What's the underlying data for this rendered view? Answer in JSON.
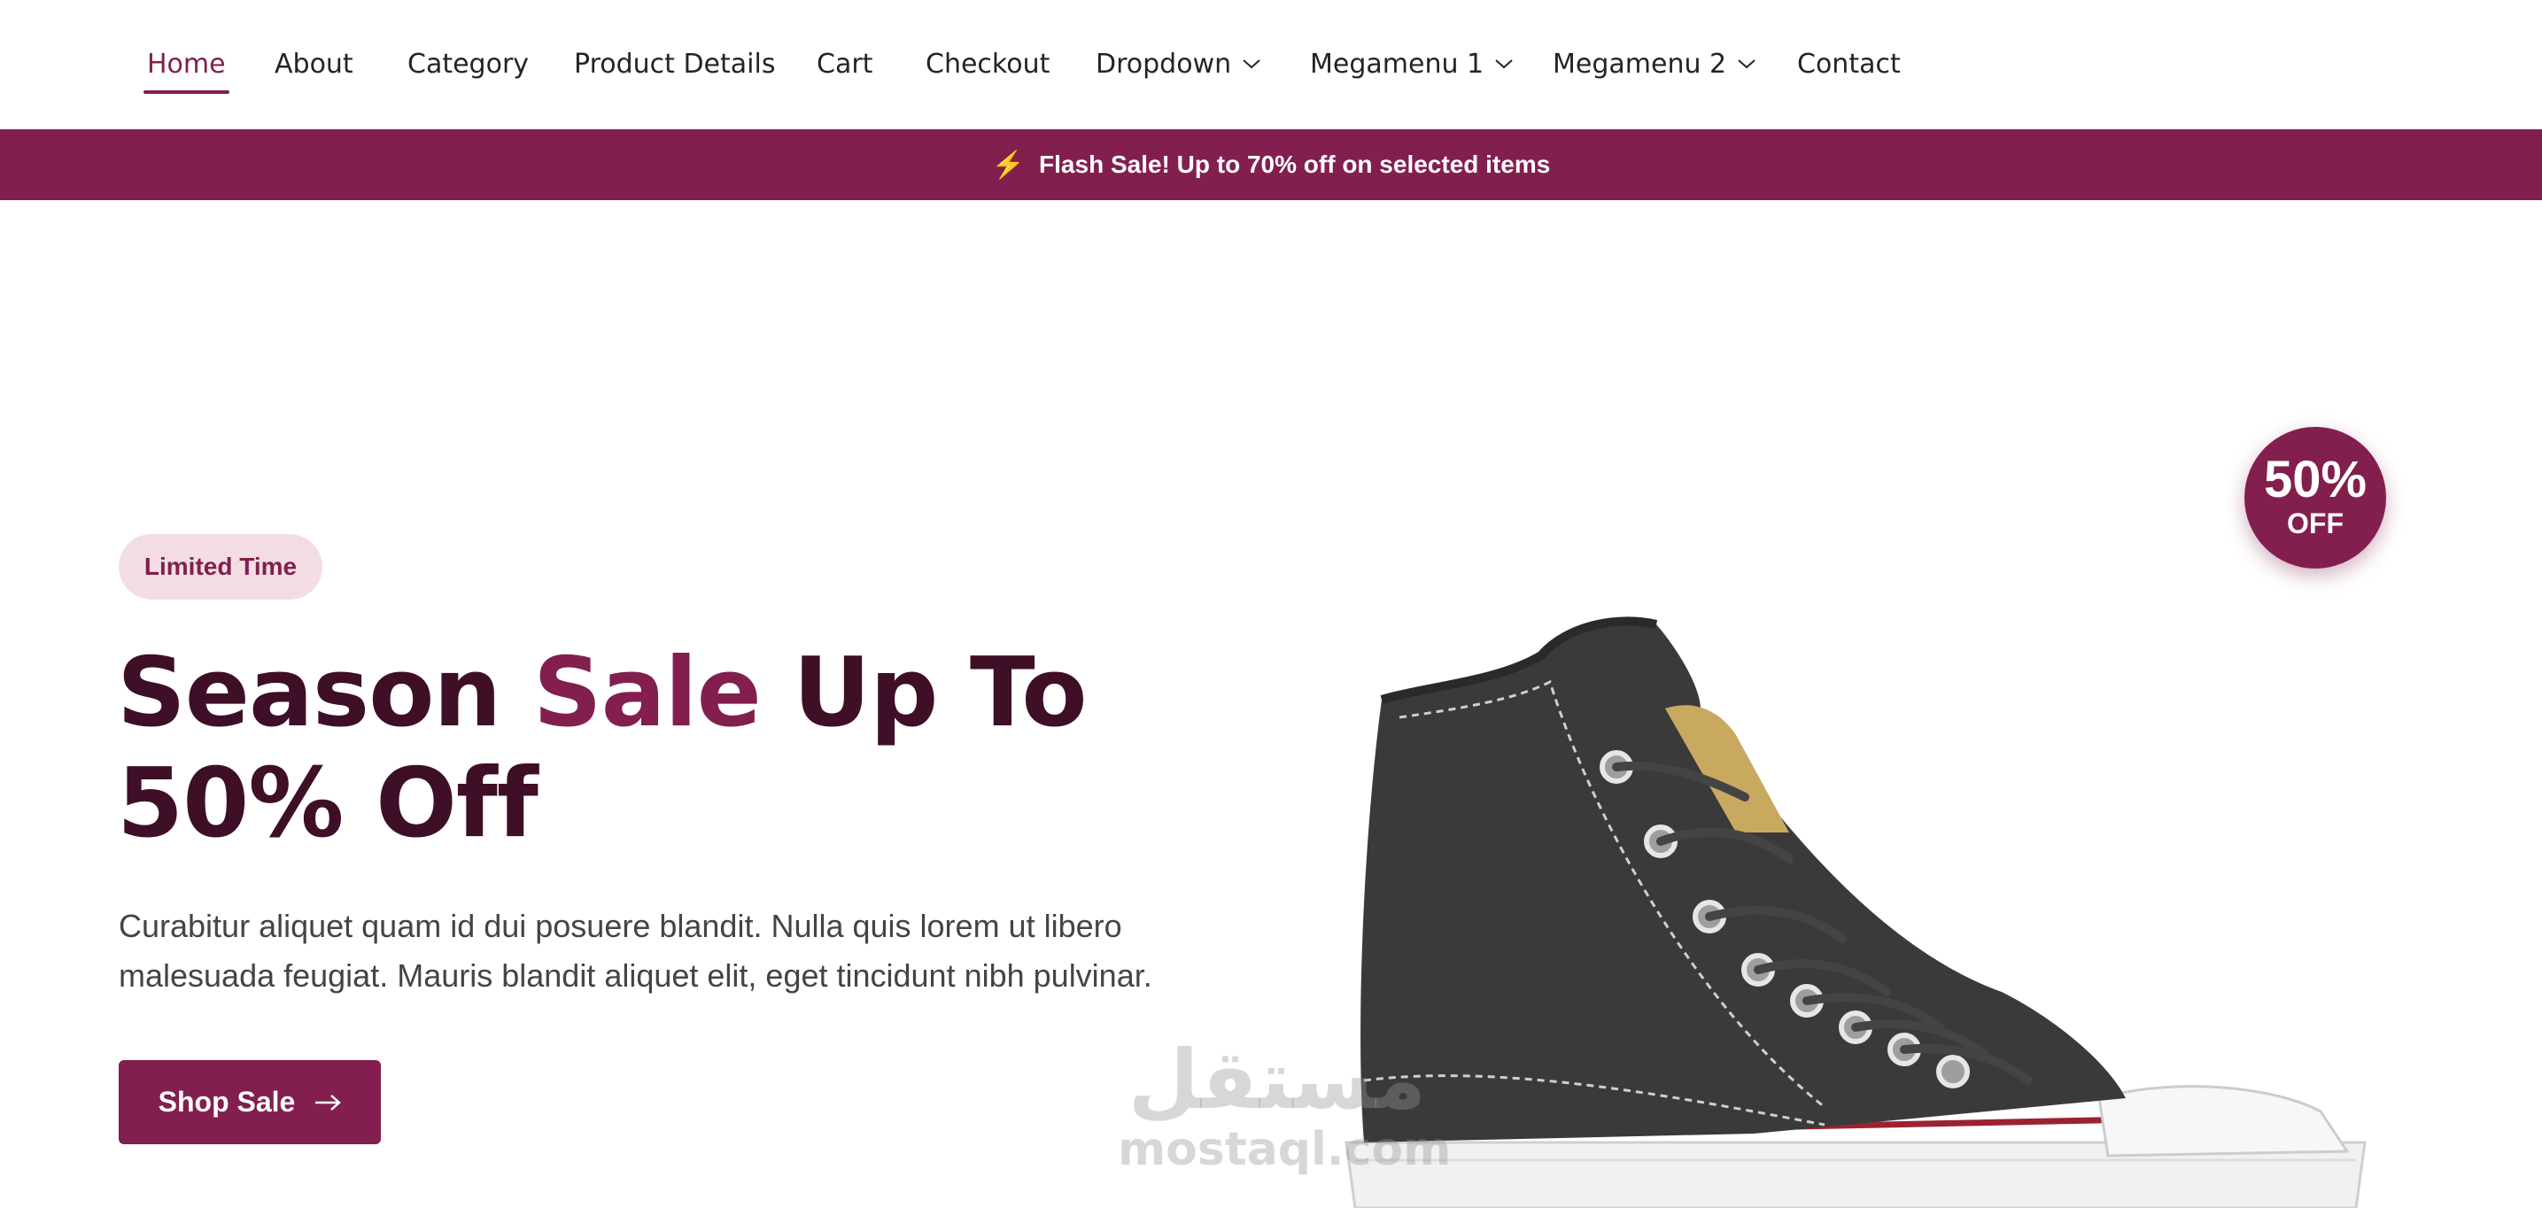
{
  "nav": {
    "items": [
      {
        "label": "Home",
        "active": true
      },
      {
        "label": "About"
      },
      {
        "label": "Category"
      },
      {
        "label": "Product Details"
      },
      {
        "label": "Cart"
      },
      {
        "label": "Checkout"
      },
      {
        "label": "Dropdown",
        "has_dropdown": true
      },
      {
        "label": "Megamenu 1",
        "has_dropdown": true
      },
      {
        "label": "Megamenu 2",
        "has_dropdown": true
      },
      {
        "label": "Contact"
      }
    ]
  },
  "promo": {
    "icon": "lightning-bolt-icon",
    "text": "Flash Sale! Up to 70% off on selected items"
  },
  "hero": {
    "badge": "Limited Time",
    "headline_before": "Season ",
    "headline_highlight": "Sale",
    "headline_after": " Up To 50% Off",
    "description": "Curabitur aliquet quam id dui posuere blandit. Nulla quis lorem ut libero malesuada feugiat. Mauris blandit aliquet elit, eget tincidunt nibh pulvinar.",
    "cta_label": "Shop Sale",
    "discount_percent": "50%",
    "discount_label": "OFF"
  },
  "watermark": {
    "arabic": "مستقل",
    "latin": "mostaql.com"
  },
  "colors": {
    "brand": "#821f4e",
    "brand_dark": "#3e0f26",
    "badge_bg": "#f3dde5",
    "bolt": "#f7c948"
  }
}
